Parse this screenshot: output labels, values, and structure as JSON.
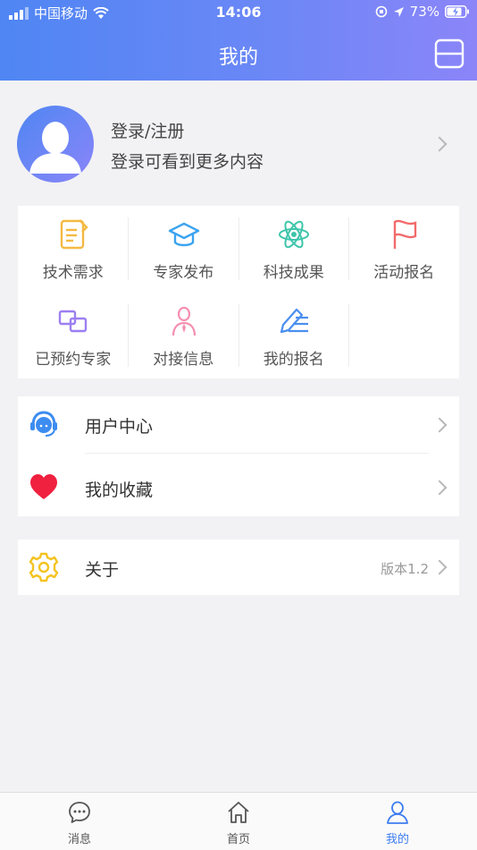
{
  "status_bar": {
    "carrier": "中国移动",
    "time": "14:06",
    "battery": "73%"
  },
  "header": {
    "title": "我的"
  },
  "profile": {
    "title": "登录/注册",
    "subtitle": "登录可看到更多内容"
  },
  "grid": {
    "items": [
      {
        "label": "技术需求",
        "icon": "document-edit-icon",
        "color": "#f4b942"
      },
      {
        "label": "专家发布",
        "icon": "graduation-cap-icon",
        "color": "#3ba4f0"
      },
      {
        "label": "科技成果",
        "icon": "atom-icon",
        "color": "#3fc5ab"
      },
      {
        "label": "活动报名",
        "icon": "flag-icon",
        "color": "#f26b6b"
      },
      {
        "label": "已预约专家",
        "icon": "linked-squares-icon",
        "color": "#9c7ff0"
      },
      {
        "label": "对接信息",
        "icon": "person-tie-icon",
        "color": "#f58fb0"
      },
      {
        "label": "我的报名",
        "icon": "pen-lines-icon",
        "color": "#4a8ef0"
      }
    ]
  },
  "menu": {
    "user_center": {
      "label": "用户中心",
      "icon": "customer-service-icon"
    },
    "favorites": {
      "label": "我的收藏",
      "icon": "heart-icon"
    },
    "about": {
      "label": "关于",
      "value": "版本1.2",
      "icon": "gear-icon"
    }
  },
  "tabbar": {
    "tabs": [
      {
        "label": "消息",
        "icon": "chat-bubble-icon"
      },
      {
        "label": "首页",
        "icon": "home-icon"
      },
      {
        "label": "我的",
        "icon": "user-icon"
      }
    ],
    "active_index": 2,
    "active_color": "#3d7cf1"
  }
}
